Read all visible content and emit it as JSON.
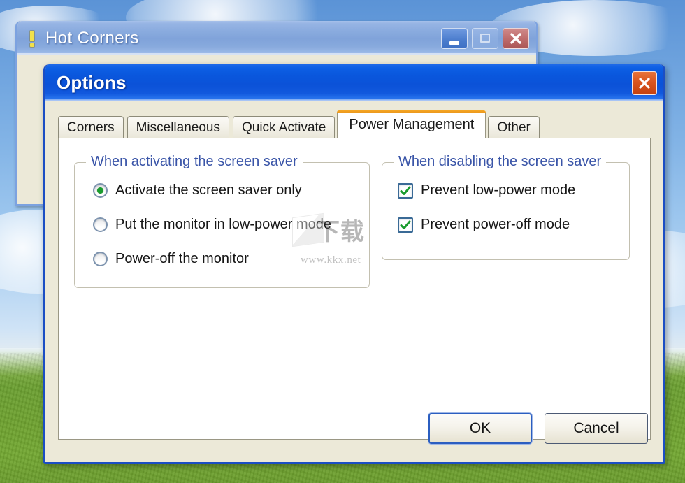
{
  "desktop": {
    "wallpaper_name": "bliss-wallpaper",
    "sky_color": "#6ea3de",
    "grass_color": "#6ba031"
  },
  "background_window": {
    "title": "Hot Corners",
    "icon": "exclamation-icon",
    "controls": {
      "minimize": "minimize-icon",
      "maximize": "maximize-icon",
      "close": "close-icon"
    }
  },
  "dialog": {
    "title": "Options",
    "close_label": "close-icon",
    "tabs": [
      {
        "label": "Corners",
        "active": false
      },
      {
        "label": "Miscellaneous",
        "active": false
      },
      {
        "label": "Quick Activate",
        "active": false
      },
      {
        "label": "Power Management",
        "active": true
      },
      {
        "label": "Other",
        "active": false
      }
    ],
    "active_tab_accent": "#f5a623",
    "groups": [
      {
        "title": "When activating the screen saver",
        "type": "radio",
        "options": [
          {
            "label": "Activate the screen saver only",
            "checked": true
          },
          {
            "label": "Put the monitor in low-power mode",
            "checked": false
          },
          {
            "label": "Power-off the monitor",
            "checked": false
          }
        ]
      },
      {
        "title": "When disabling the screen saver",
        "type": "checkbox",
        "options": [
          {
            "label": "Prevent low-power mode",
            "checked": true
          },
          {
            "label": "Prevent power-off mode",
            "checked": true
          }
        ]
      }
    ],
    "buttons": {
      "ok": "OK",
      "cancel": "Cancel"
    },
    "title_color": "#0a57dd",
    "group_title_color": "#3a55a8",
    "check_color": "#1a9c2e"
  },
  "watermark": {
    "glyphs": "下载",
    "url": "www.kkx.net"
  }
}
